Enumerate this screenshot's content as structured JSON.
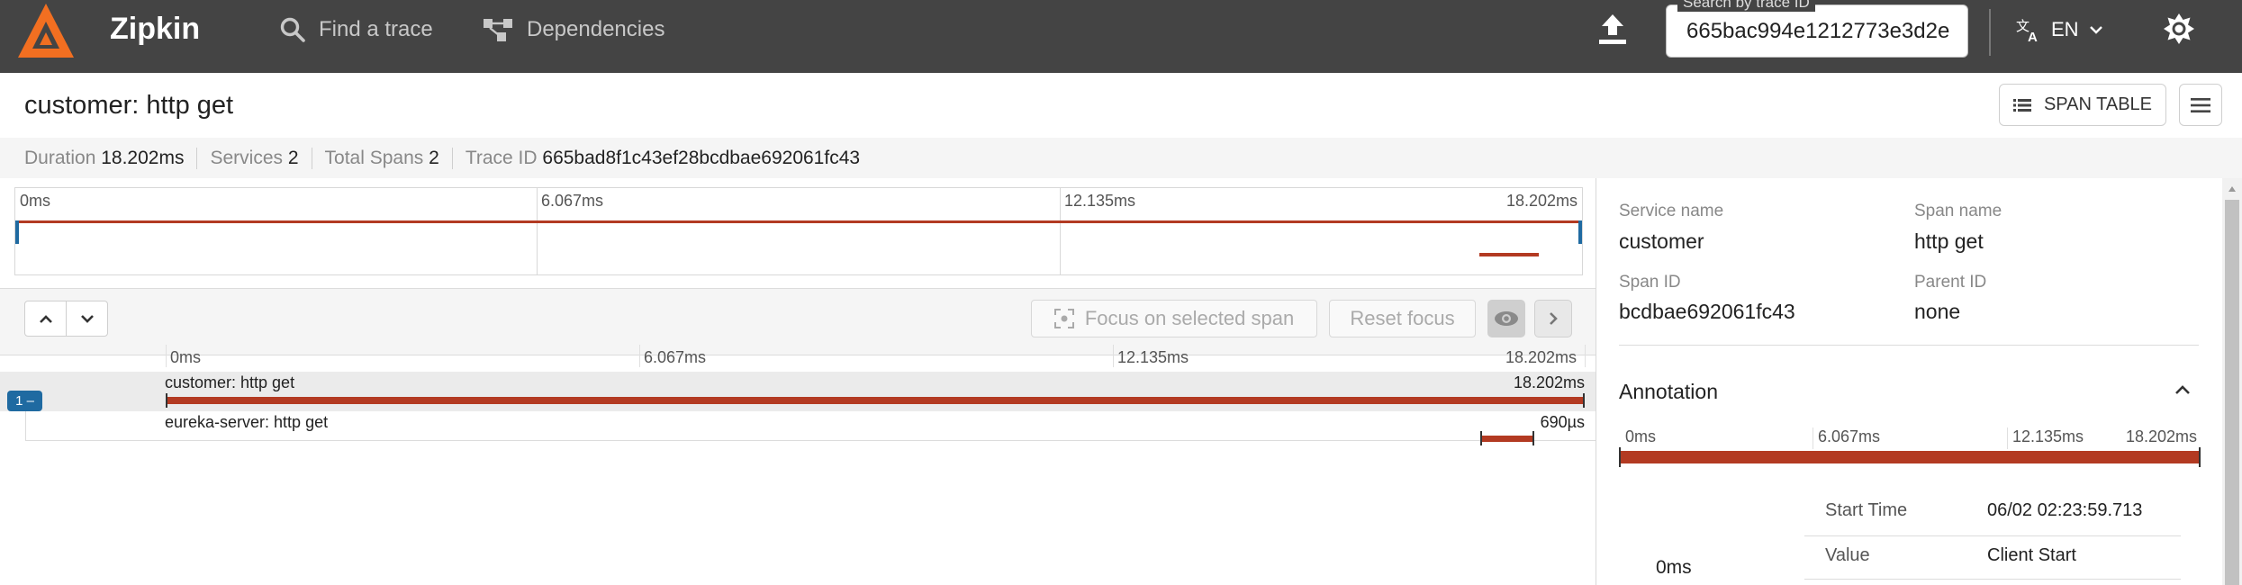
{
  "header": {
    "app_name": "Zipkin",
    "nav": [
      {
        "label": "Find a trace",
        "icon": "search-icon"
      },
      {
        "label": "Dependencies",
        "icon": "dependencies-icon"
      }
    ],
    "search": {
      "legend": "Search by trace ID",
      "value": "665bac994e1212773e3d2e"
    },
    "language": "EN"
  },
  "trace": {
    "title": "customer: http get",
    "span_table_label": "SPAN TABLE",
    "info": [
      {
        "key": "Duration",
        "value": "18.202ms"
      },
      {
        "key": "Services",
        "value": "2"
      },
      {
        "key": "Total Spans",
        "value": "2"
      },
      {
        "key": "Trace ID",
        "value": "665bad8f1c43ef28bcdbae692061fc43"
      }
    ]
  },
  "minimap": {
    "ticks": [
      "0ms",
      "6.067ms",
      "12.135ms",
      "18.202ms"
    ]
  },
  "controls": {
    "focus_label": "Focus on selected span",
    "reset_label": "Reset focus"
  },
  "timeline": {
    "ticks": [
      "0ms",
      "6.067ms",
      "12.135ms",
      "18.202ms"
    ],
    "spans": [
      {
        "label": "customer: http get",
        "duration": "18.202ms",
        "depth_badge": "1 –",
        "start_frac": 0.0,
        "width_frac": 1.0
      },
      {
        "label": "eureka-server: http get",
        "duration": "690µs",
        "start_frac": 0.9267,
        "width_frac": 0.0379
      }
    ],
    "colors": {
      "bar": "#b33a22",
      "badge": "#1f6aa1",
      "selected_row": "#ebebeb",
      "accent": "#f26f21"
    }
  },
  "detail": {
    "service_name_label": "Service name",
    "service_name": "customer",
    "span_name_label": "Span name",
    "span_name": "http get",
    "span_id_label": "Span ID",
    "span_id": "bcdbae692061fc43",
    "parent_id_label": "Parent ID",
    "parent_id": "none",
    "annotation_title": "Annotation",
    "annotation_ticks": [
      "0ms",
      "6.067ms",
      "12.135ms",
      "18.202ms"
    ],
    "annotation_time": "0ms",
    "annotation_rows": [
      {
        "key": "Start Time",
        "value": "06/02 02:23:59.713"
      },
      {
        "key": "Value",
        "value": "Client Start"
      }
    ]
  }
}
